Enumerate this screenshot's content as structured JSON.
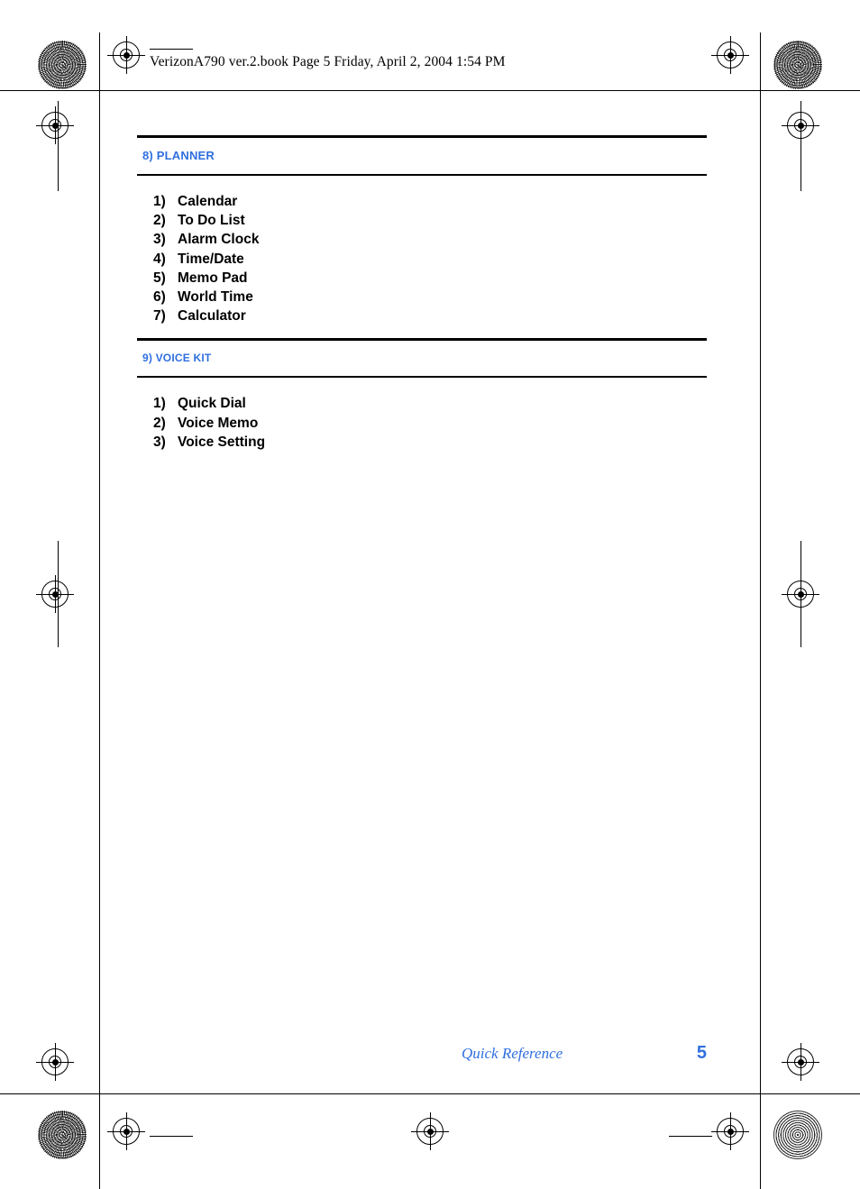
{
  "header": {
    "file_line": "VerizonA790 ver.2.book  Page 5  Friday, April 2, 2004  1:54 PM"
  },
  "sections": [
    {
      "title": "8) PLANNER",
      "items": [
        {
          "num": "1)",
          "label": "Calendar"
        },
        {
          "num": "2)",
          "label": "To Do List"
        },
        {
          "num": "3)",
          "label": "Alarm Clock"
        },
        {
          "num": "4)",
          "label": "Time/Date"
        },
        {
          "num": "5)",
          "label": "Memo Pad"
        },
        {
          "num": "6)",
          "label": "World Time"
        },
        {
          "num": "7)",
          "label": "Calculator"
        }
      ]
    },
    {
      "title": "9) VOICE KIT",
      "items": [
        {
          "num": "1)",
          "label": "Quick Dial"
        },
        {
          "num": "2)",
          "label": "Voice Memo"
        },
        {
          "num": "3)",
          "label": "Voice Setting"
        }
      ]
    }
  ],
  "footer": {
    "label": "Quick Reference",
    "page_number": "5"
  },
  "colors": {
    "accent": "#2f6fe0",
    "rule": "#000000",
    "text": "#000000"
  }
}
